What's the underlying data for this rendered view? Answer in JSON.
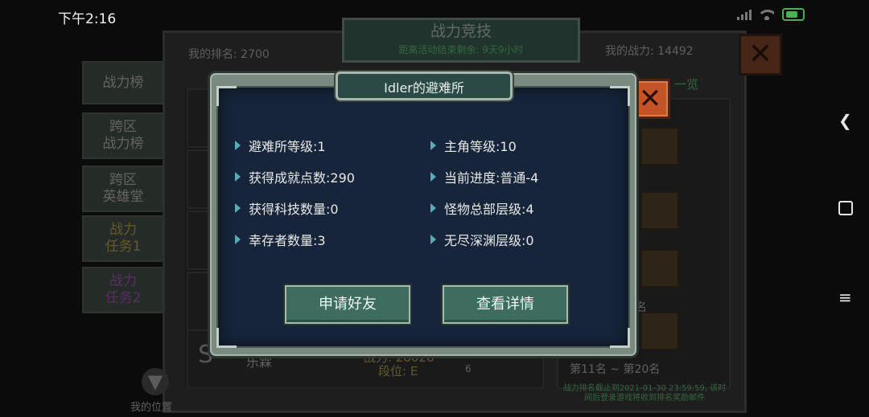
{
  "status_bar": {
    "time": "下午2:16"
  },
  "background": {
    "title": "战力竞技",
    "countdown": "距离活动结束剩余: 9天9小时",
    "my_rank": "我的排名: 2700",
    "my_power": "我的战力: 14492",
    "side_tabs": [
      {
        "label": "战力榜"
      },
      {
        "label": "跨区\n战力榜"
      },
      {
        "label": "跨区\n英雄堂"
      },
      {
        "label": "战力\n任务1"
      },
      {
        "label": "战力\n任务2"
      }
    ],
    "row_name": "乐霖",
    "row_power": "战力: 28026",
    "row_tier": "段位: E",
    "right_header": "一览",
    "right_rank_label": "名",
    "right_footer": "第11名 ~ 第20名",
    "notice": "战力排名截止到2021-01-30 23:59:59, 该时间后登录游戏将收到排名奖励邮件",
    "my_location": "我的位置",
    "row_badge_value": "6"
  },
  "dialog": {
    "title": "Idler的避难所",
    "stats_left": [
      "避难所等级:1",
      "获得成就点数:290",
      "获得科技数量:0",
      "幸存者数量:3"
    ],
    "stats_right": [
      "主角等级:10",
      "当前进度:普通-4",
      "怪物总部层级:4",
      "无尽深渊层级:0"
    ],
    "buttons": {
      "add_friend": "申请好友",
      "view_details": "查看详情"
    }
  },
  "icons": [
    "close-icon",
    "back-icon",
    "home-icon",
    "recent-apps-icon",
    "signal-icon",
    "wifi-icon",
    "battery-icon",
    "arrow-down-icon",
    "triangle-bullet-icon"
  ],
  "colors": {
    "accent_green": "#6fe28d",
    "dialog_bg": "#16253a",
    "button_bg": "#3e6d60",
    "close_orange": "#c3542a"
  }
}
